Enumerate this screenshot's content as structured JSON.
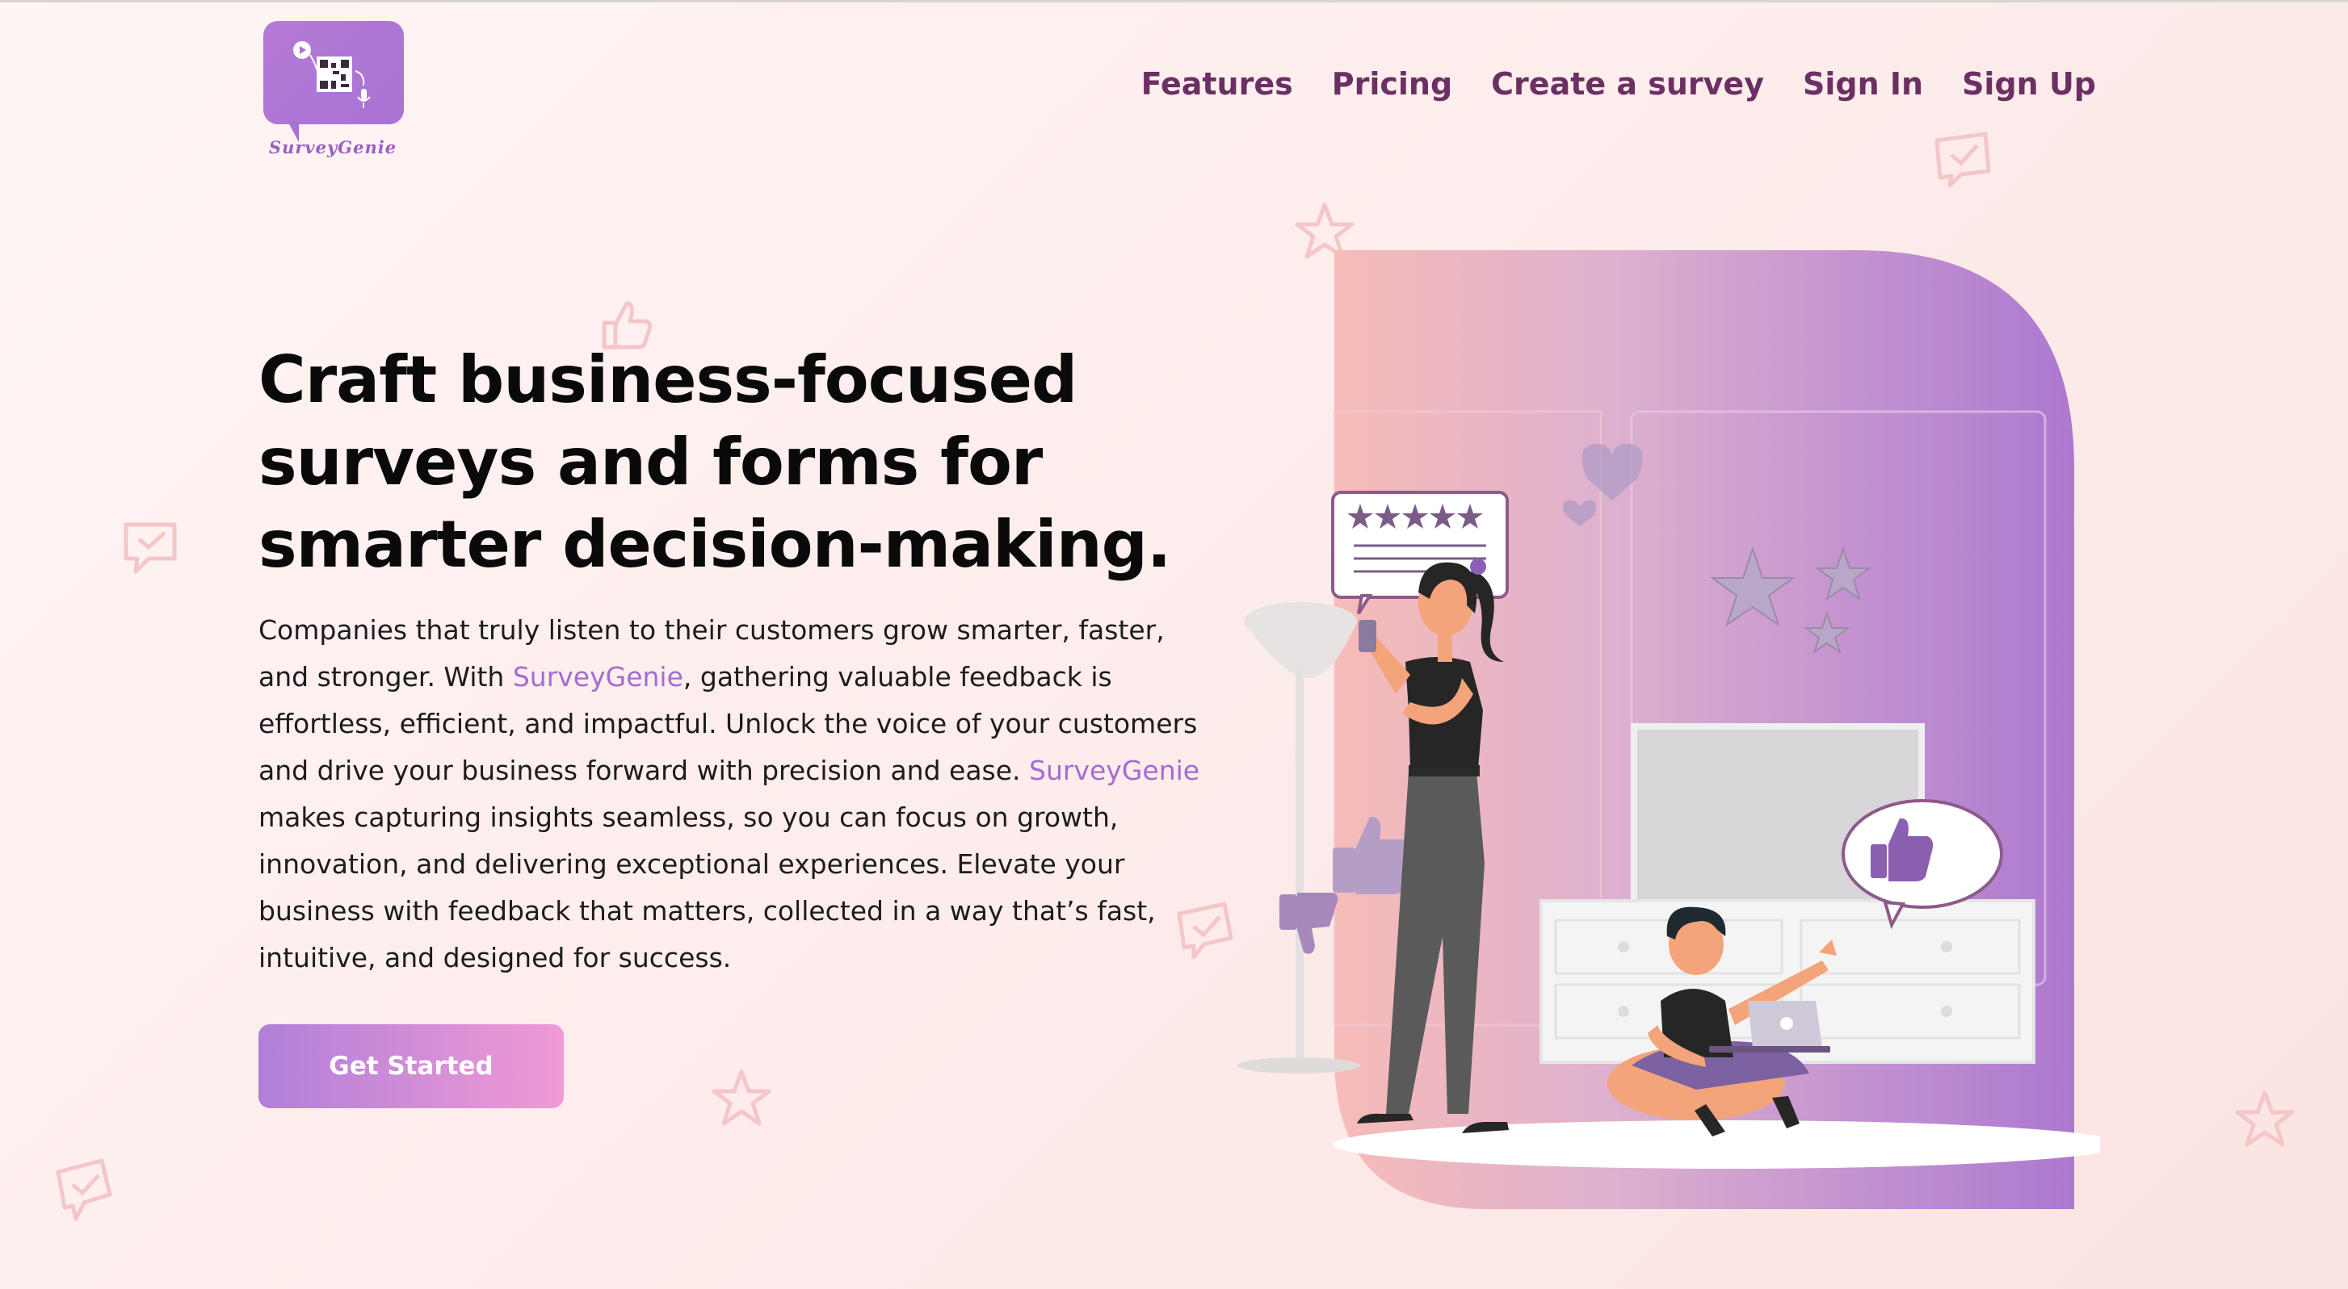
{
  "logo": {
    "brand_text": "SurveyGenie",
    "icon": "qr-code-chat-logo"
  },
  "nav": {
    "links": [
      "Features",
      "Pricing",
      "Create a survey",
      "Sign In",
      "Sign Up"
    ]
  },
  "hero": {
    "headline": "Craft business-focused surveys and forms for smarter decision-making.",
    "body_1": "Companies that truly listen to their customers grow smarter, faster, and stronger. With ",
    "brand_1": "SurveyGenie",
    "body_2": ", gathering valuable feedback is effortless, efficient, and impactful. Unlock the voice of your customers and drive your business forward with precision and ease. ",
    "brand_2": "SurveyGenie",
    "body_3": " makes capturing insights seamless, so you can focus on growth, innovation, and delivering exceptional experiences. Elevate your business with feedback that matters, collected in a way that’s fast, intuitive, and designed for success.",
    "cta_label": "Get Started"
  },
  "colors": {
    "nav_text": "#6b2f63",
    "brand_accent": "#a56bd1",
    "cta_gradient_start": "#b07fd8",
    "cta_gradient_end": "#f19ad6",
    "illustration_panel": "#b27fd2"
  },
  "illustration": {
    "rating_stars": 5,
    "icons": [
      "star-rating-bubble-icon",
      "heart-icon",
      "thumbs-up-bubble-icon",
      "thumbs-up-icon",
      "thumbs-down-icon",
      "star-icon"
    ]
  }
}
